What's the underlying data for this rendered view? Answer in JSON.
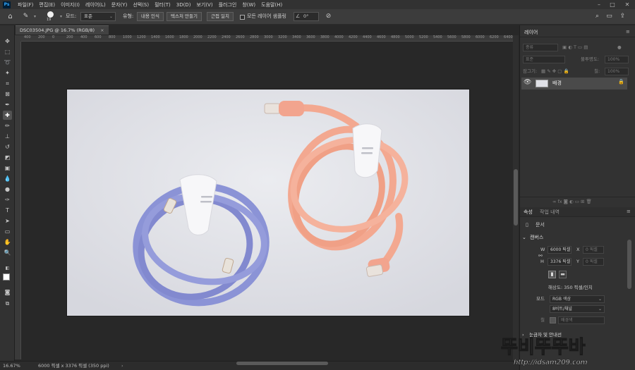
{
  "menu": {
    "logo": "Ps",
    "items": [
      "파일(F)",
      "편집(E)",
      "이미지(I)",
      "레이어(L)",
      "문자(Y)",
      "선택(S)",
      "필터(T)",
      "3D(D)",
      "보기(V)",
      "플러그인",
      "창(W)",
      "도움말(H)"
    ]
  },
  "options": {
    "brush_size": "19",
    "mode_label": "모드:",
    "mode_value": "표준",
    "type_label": "유형:",
    "btn_content_aware": "내용 인식",
    "btn_create_texture": "텍스처 만들기",
    "btn_proximity_match": "근접 일치",
    "sample_all_layers": "모든 레이어 샘플링",
    "angle_value": "0°"
  },
  "document": {
    "tab_title": "DSC03504.JPG @ 16.7% (RGB/8)",
    "ruler_ticks": [
      "400",
      "200",
      "0",
      "200",
      "400",
      "600",
      "800",
      "1000",
      "1200",
      "1400",
      "1600",
      "1800",
      "2000",
      "2200",
      "2400",
      "2600",
      "2800",
      "3000",
      "3200",
      "3400",
      "3600",
      "3800",
      "4000",
      "4200",
      "4400",
      "4600",
      "4800",
      "5000",
      "5200",
      "5400",
      "5600",
      "5800",
      "6000",
      "6200",
      "6400"
    ]
  },
  "status": {
    "zoom": "16.67%",
    "doc_info": "6000 픽셀 x 3376 픽셀 (350 ppi)"
  },
  "layers_panel": {
    "title": "레이어",
    "filter_kind": "종류",
    "blend_mode": "표준",
    "opacity_label": "불투명도:",
    "opacity_value": "100%",
    "lock_label": "잠그기:",
    "fill_label": "칠:",
    "fill_value": "100%",
    "layer_name": "배경"
  },
  "properties_panel": {
    "tab_properties": "속성",
    "tab_history": "작업 내역",
    "document_label": "문서",
    "canvas_section": "캔버스",
    "w_label": "W",
    "w_value": "6000 픽셀",
    "h_label": "H",
    "h_value": "3376 픽셀",
    "x_label": "X",
    "x_value": "0 픽셀",
    "y_label": "Y",
    "y_value": "0 픽셀",
    "resolution": "해상도: 350 픽셀/인치",
    "mode_label": "모드",
    "mode_value": "RGB 색상",
    "depth_value": "8비트/채널",
    "fill_label": "칠",
    "fill_value": "배경색",
    "rulers_section": "눈금자 및 안내선"
  },
  "watermark": {
    "text_top": "뚜비뚜뚜바",
    "text_bottom": "http://idsam209.com"
  },
  "colors": {
    "accent": "#31a8ff",
    "cable_blue": "#8b93d6",
    "cable_pink": "#f3a890",
    "background_canvas": "#dfe0e6"
  }
}
